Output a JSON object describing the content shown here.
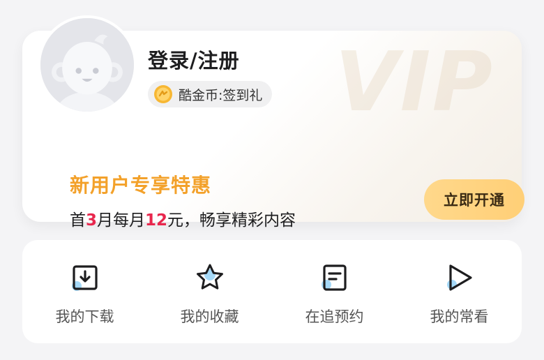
{
  "member_card": {
    "login_label": "登录/注册",
    "coin_label": "酷金币:签到礼",
    "promo": {
      "title": "新用户专享特惠",
      "desc_prefix": "首",
      "desc_months": "3",
      "desc_middle": "月每月",
      "desc_price": "12",
      "desc_suffix": "元，畅享精彩内容"
    },
    "open_button_label": "立即开通",
    "watermark": "VIP"
  },
  "quick_actions": [
    {
      "label": "我的下载",
      "icon": "download-icon"
    },
    {
      "label": "我的收藏",
      "icon": "star-icon"
    },
    {
      "label": "在追预约",
      "icon": "bookmark-list-icon"
    },
    {
      "label": "我的常看",
      "icon": "play-icon"
    }
  ],
  "colors": {
    "promo_title": "#f3a12a",
    "promo_number": "#e8274d",
    "open_button_bg": "#ffd47f",
    "icon_stroke": "#1d1d1f",
    "icon_accent": "#8fcff6"
  }
}
